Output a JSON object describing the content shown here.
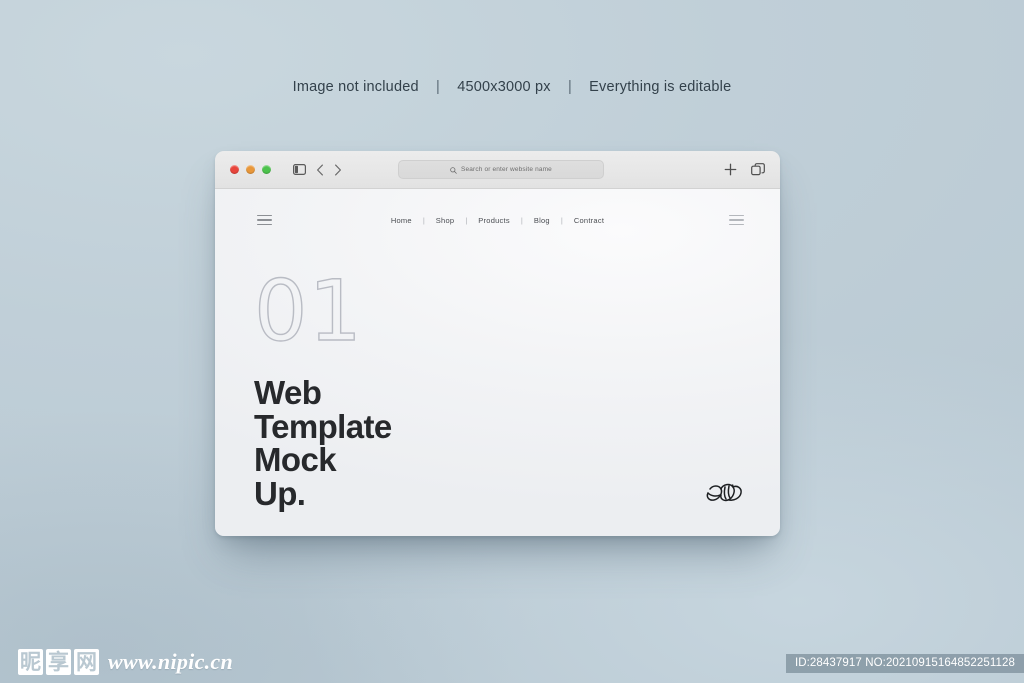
{
  "caption": {
    "part1": "Image not included",
    "part2": "4500x3000 px",
    "part3": "Everything is editable",
    "separator": "|"
  },
  "browser": {
    "traffic_lights": [
      {
        "name": "close",
        "color": "#e8453c"
      },
      {
        "name": "minimize",
        "color": "#e8973a"
      },
      {
        "name": "zoom",
        "color": "#4cc24c"
      }
    ],
    "sidebar_icon": "sidebar-toggle-icon",
    "back_icon": "chevron-left-icon",
    "forward_icon": "chevron-right-icon",
    "address_bar": {
      "value": "",
      "placeholder": "Search or enter website name",
      "icon": "search-icon"
    },
    "new_tab_icon": "plus-icon",
    "tab_overview_icon": "tab-overview-icon"
  },
  "site": {
    "menu_icon": "hamburger-menu-icon",
    "nav": [
      {
        "label": "Home"
      },
      {
        "label": "Shop"
      },
      {
        "label": "Products"
      },
      {
        "label": "Blog"
      },
      {
        "label": "Contract"
      }
    ],
    "nav_divider": "|",
    "hero": {
      "number": "01",
      "line1": "Web",
      "line2": "Template",
      "line3": "Mock",
      "line4": "Up."
    },
    "logo": "script-monogram-logo"
  },
  "watermark": {
    "cn_chars": [
      "昵",
      "享",
      "网"
    ],
    "url": "www.nipic.cn",
    "id_text": "ID:28437917 NO:20210915164852251128"
  },
  "colors": {
    "background": "#c2d1da",
    "toolbar": "#e8e8e8",
    "page": "#f3f4f6",
    "heading": "#27292c",
    "number_outline": "#b9bcc4"
  }
}
